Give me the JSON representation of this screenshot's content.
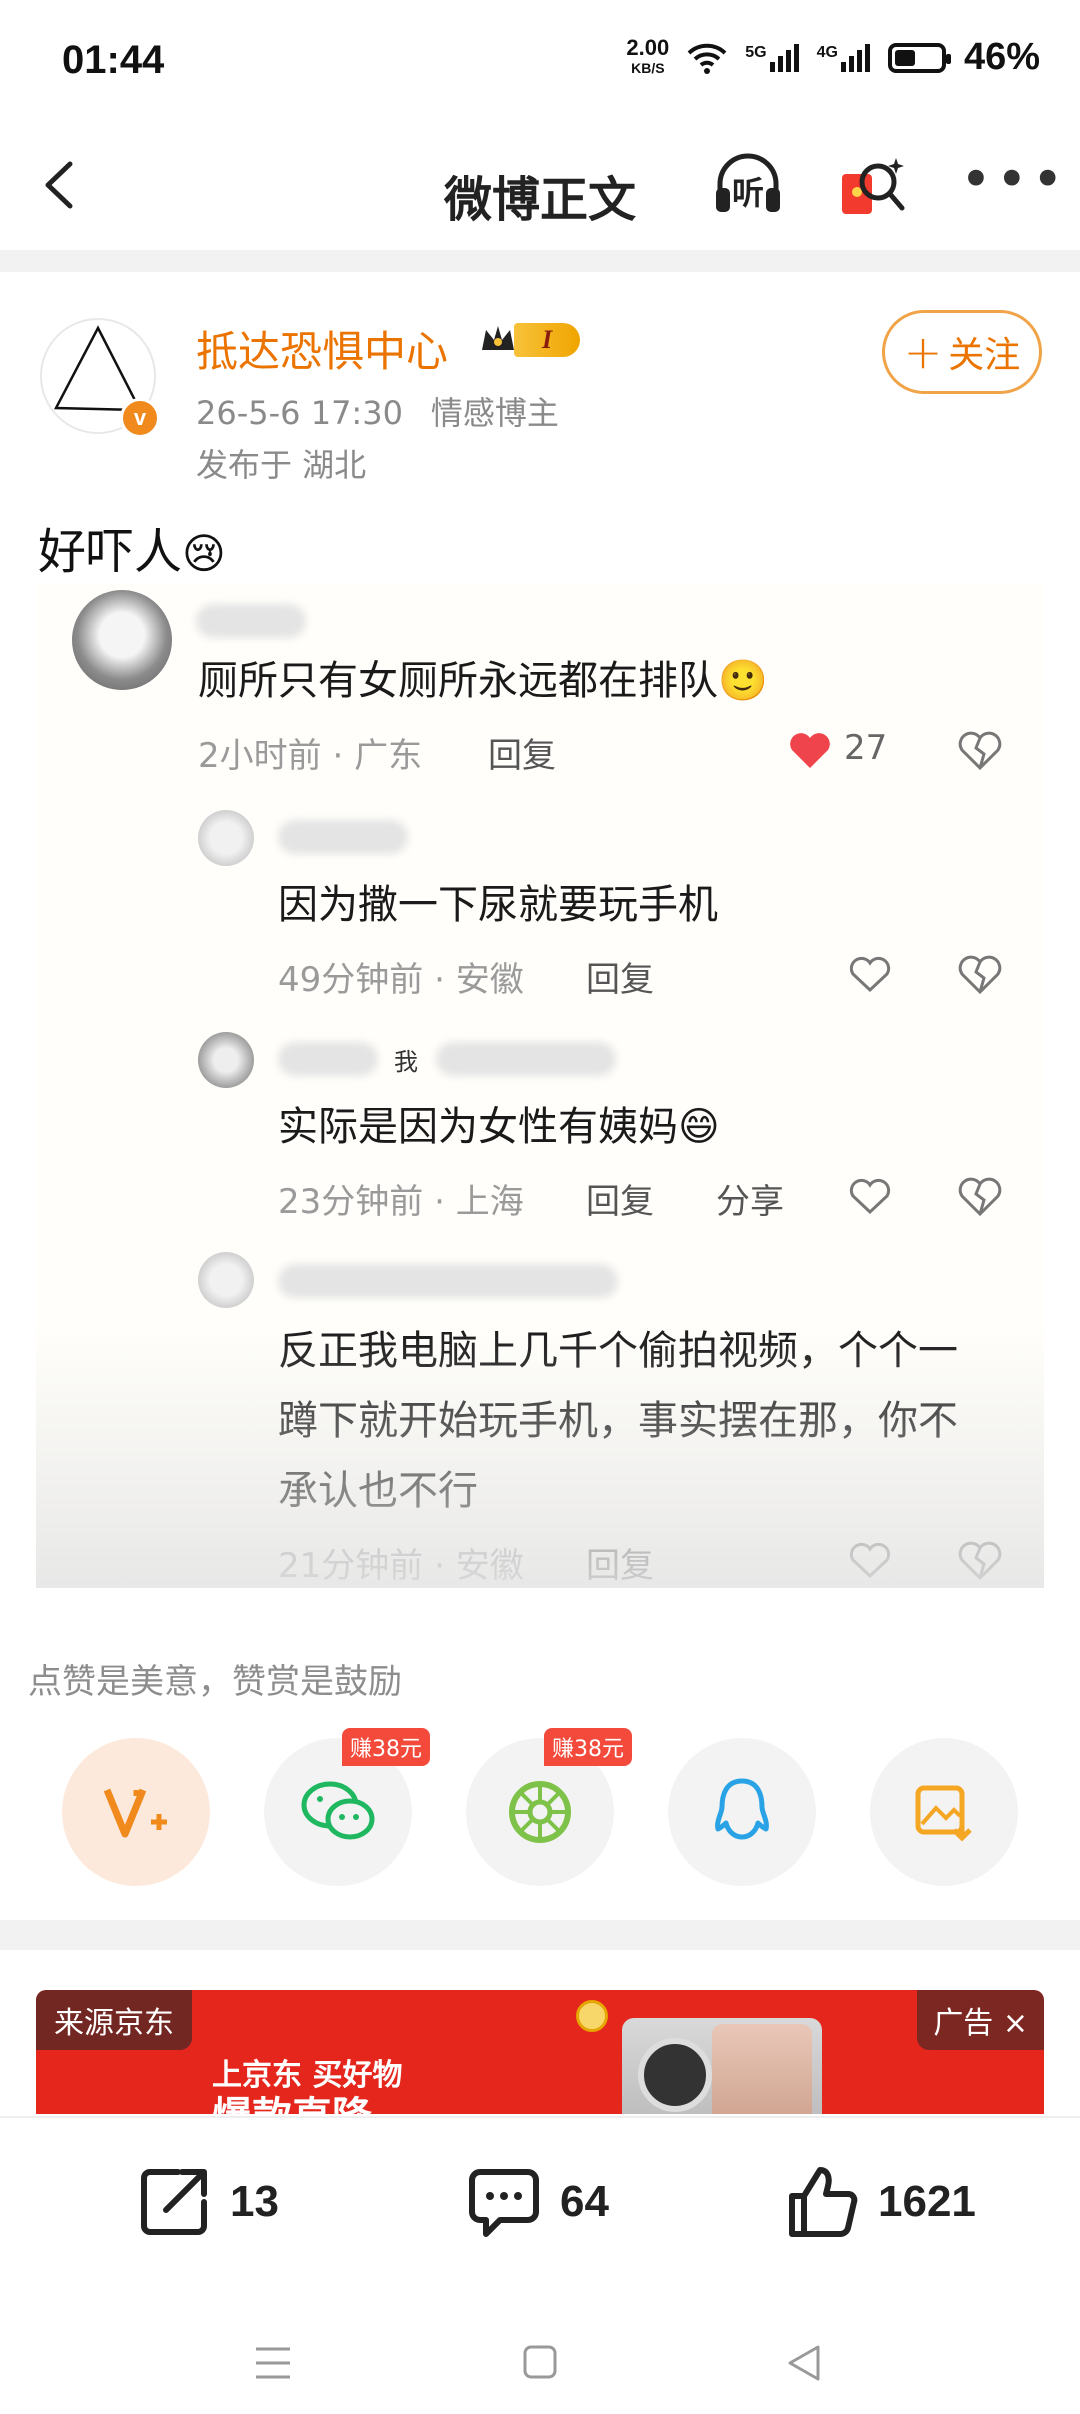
{
  "status": {
    "time": "01:44",
    "net_speed": "2.00",
    "net_unit": "KB/S",
    "sig1": "5G",
    "sig2": "4G",
    "battery_pct": "46%",
    "battery_level": 0.46
  },
  "nav": {
    "title": "微博正文",
    "listen_label": "听"
  },
  "post": {
    "author": "抵达恐惧中心",
    "level_badge": "I",
    "date": "26-5-6 17:30",
    "role": "情感博主",
    "location": "发布于 湖北",
    "follow_label": "关注",
    "text": "好吓人",
    "text_emoji": "😢"
  },
  "screenshot": {
    "comments": [
      {
        "text": "厕所只有女厕所永远都在排队",
        "emoji": "🙂",
        "time": "2小时前",
        "region": "广东",
        "reply": "回复",
        "likes": "27"
      },
      {
        "text": "因为撒一下尿就要玩手机",
        "time": "49分钟前",
        "region": "安徽",
        "reply": "回复"
      },
      {
        "text": "实际是因为女性有姨妈",
        "emoji": "😄",
        "time": "23分钟前",
        "region": "上海",
        "reply": "回复",
        "share": "分享",
        "tag": "我"
      },
      {
        "text_line1": "反正我电脑上几千个偷拍视频，个个一",
        "text_line2": "蹲下就开始玩手机，事实摆在那，你不",
        "text_line3": "承认也不行",
        "time": "21分钟前",
        "region": "安徽",
        "reply": "回复"
      }
    ],
    "dot": "·"
  },
  "reward": {
    "text": "点赞是美意，赞赏是鼓励",
    "earn1": "赚38元",
    "earn2": "赚38元"
  },
  "ad": {
    "source": "来源京东",
    "tag": "广告",
    "close": "×",
    "slogan": "上京东 买好物",
    "big": "爆款直降"
  },
  "actions": {
    "repost": "13",
    "comment": "64",
    "like": "1621"
  },
  "colors": {
    "accent": "#eb7400",
    "heart": "#f0444c",
    "wechat": "#1fb861",
    "moments": "#7ec24a",
    "qq": "#2aa3e6",
    "save": "#f5a623"
  }
}
